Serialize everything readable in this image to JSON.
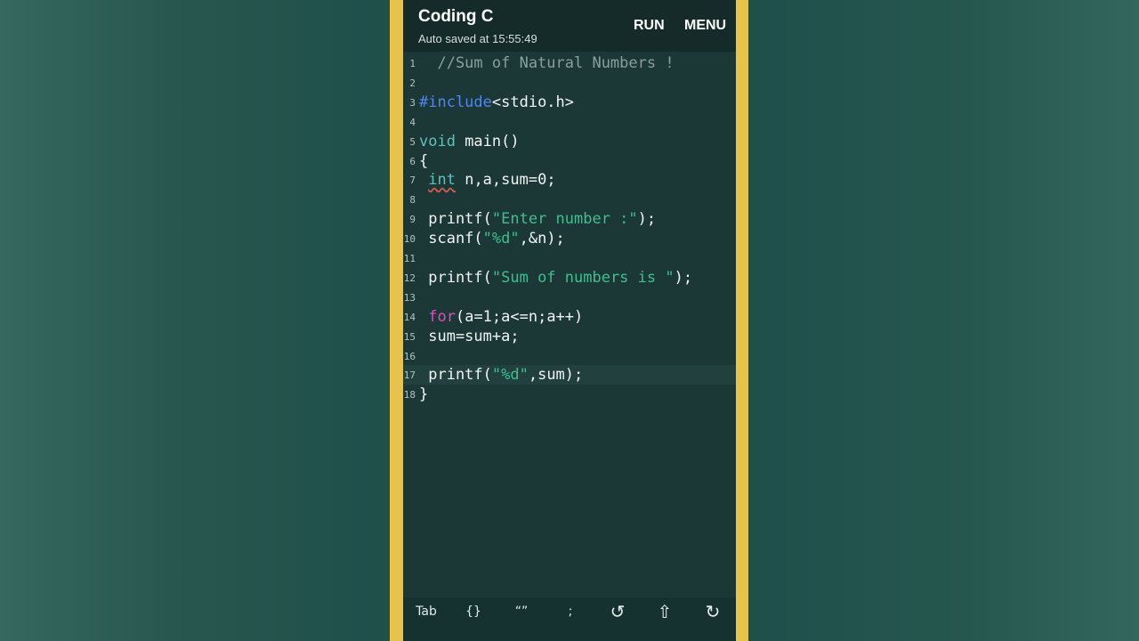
{
  "app": {
    "title": "Coding C",
    "subtitle": "Auto saved at 15:55:49",
    "run_label": "RUN",
    "menu_label": "MENU"
  },
  "editor": {
    "current_line": 17,
    "lines": [
      {
        "n": "1",
        "tokens": [
          {
            "t": "  //Sum of Natural Numbers !",
            "c": "comment"
          }
        ]
      },
      {
        "n": "2",
        "tokens": []
      },
      {
        "n": "3",
        "tokens": [
          {
            "t": "#include",
            "c": "pre"
          },
          {
            "t": "<stdio.h>",
            "c": "plain"
          }
        ]
      },
      {
        "n": "4",
        "tokens": []
      },
      {
        "n": "5",
        "tokens": [
          {
            "t": "void",
            "c": "type"
          },
          {
            "t": " main()",
            "c": "plain"
          }
        ]
      },
      {
        "n": "6",
        "tokens": [
          {
            "t": "{",
            "c": "plain"
          }
        ]
      },
      {
        "n": "7",
        "tokens": [
          {
            "t": " ",
            "c": "plain"
          },
          {
            "t": "int",
            "c": "type err"
          },
          {
            "t": " n,a,sum=0;",
            "c": "plain"
          }
        ]
      },
      {
        "n": "8",
        "tokens": []
      },
      {
        "n": "9",
        "tokens": [
          {
            "t": " printf(",
            "c": "plain"
          },
          {
            "t": "\"Enter number :\"",
            "c": "str"
          },
          {
            "t": ");",
            "c": "plain"
          }
        ]
      },
      {
        "n": "10",
        "tokens": [
          {
            "t": " scanf(",
            "c": "plain"
          },
          {
            "t": "\"%d\"",
            "c": "str"
          },
          {
            "t": ",&n);",
            "c": "plain"
          }
        ]
      },
      {
        "n": "11",
        "tokens": []
      },
      {
        "n": "12",
        "tokens": [
          {
            "t": " printf(",
            "c": "plain"
          },
          {
            "t": "\"Sum of numbers is \"",
            "c": "str"
          },
          {
            "t": ");",
            "c": "plain"
          }
        ]
      },
      {
        "n": "13",
        "tokens": []
      },
      {
        "n": "14",
        "tokens": [
          {
            "t": " ",
            "c": "plain"
          },
          {
            "t": "for",
            "c": "kw"
          },
          {
            "t": "(a=1;a<=n;a++)",
            "c": "plain"
          }
        ]
      },
      {
        "n": "15",
        "tokens": [
          {
            "t": " sum=sum+a;",
            "c": "plain"
          }
        ]
      },
      {
        "n": "16",
        "tokens": []
      },
      {
        "n": "17",
        "tokens": [
          {
            "t": " printf(",
            "c": "plain"
          },
          {
            "t": "\"%d\"",
            "c": "str"
          },
          {
            "t": ",sum);",
            "c": "plain"
          }
        ]
      },
      {
        "n": "18",
        "tokens": [
          {
            "t": "}",
            "c": "plain"
          }
        ]
      }
    ]
  },
  "keybar": {
    "keys": [
      {
        "label": "Tab",
        "icon": "tab-key"
      },
      {
        "label": "{}",
        "icon": "braces-key"
      },
      {
        "label": "“”",
        "icon": "quotes-key"
      },
      {
        "label": ";",
        "icon": "semicolon-key"
      },
      {
        "label": "↺",
        "icon": "undo-icon"
      },
      {
        "label": "⇧",
        "icon": "shift-icon"
      },
      {
        "label": "↻",
        "icon": "redo-icon"
      }
    ]
  },
  "colors": {
    "frame": "#e6c44a",
    "editor_bg": "#1b3836",
    "appbar_bg": "#142b29",
    "comment": "#8a9ea0",
    "preprocessor": "#4f86f0",
    "type": "#5bc3bd",
    "keyword": "#e14bbf",
    "string": "#3dbf8e"
  }
}
